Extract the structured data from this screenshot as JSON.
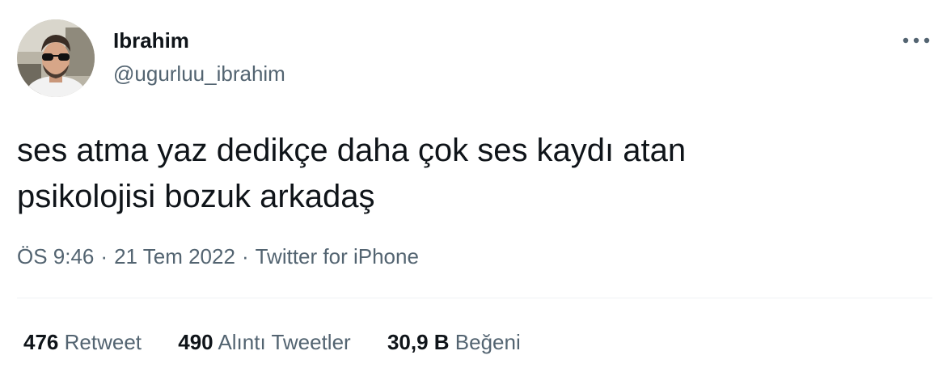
{
  "author": {
    "display_name": "Ibrahim",
    "handle": "@ugurluu_ibrahim"
  },
  "tweet": {
    "text_lines": [
      "ses atma yaz dedikçe daha çok ses kaydı atan",
      "psikolojisi bozuk arkadaş"
    ],
    "time": "ÖS 9:46",
    "date": "21 Tem 2022",
    "source": "Twitter for iPhone",
    "separator": "·"
  },
  "stats": [
    {
      "count": "476",
      "label": "Retweet"
    },
    {
      "count": "490",
      "label": "Alıntı Tweetler"
    },
    {
      "count": "30,9 B",
      "label": "Beğeni"
    }
  ],
  "icons": {
    "more": "more-horizontal-icon",
    "avatar": "profile-photo"
  }
}
